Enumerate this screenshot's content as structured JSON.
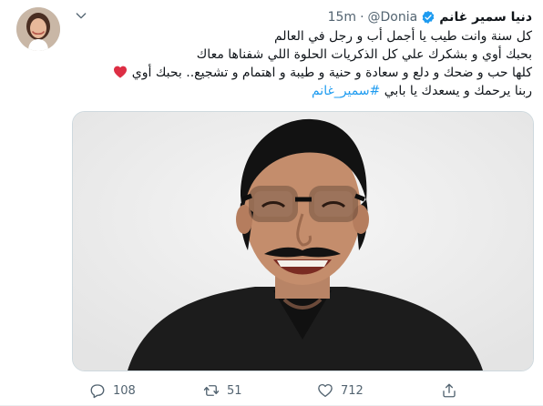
{
  "author": {
    "display_name": "دنيا سمير غانم",
    "handle": "@Donia",
    "separator": "·",
    "time": "15m",
    "verified_icon": "verified-badge-icon"
  },
  "tweet_text": {
    "line1": "كل سنة وانت طيب يا أجمل أب و رجل في العالم",
    "line2": "بحبك أوي و بشكرك علي كل الذكريات الحلوة اللي شفناها معاك",
    "line3": "كلها حب و ضحك و دلع و سعادة و حنية و طيبة و اهتمام و تشجيع.. بحبك أوي",
    "line4_text": "ربنا يرحمك و يسعدك يا بابي",
    "hashtag": "#سمير_غانم"
  },
  "media": {
    "icon": "photo-portrait"
  },
  "actions": {
    "reply_count": "108",
    "retweet_count": "51",
    "like_count": "712",
    "reply_icon": "reply-icon",
    "retweet_icon": "retweet-icon",
    "like_icon": "heart-icon",
    "share_icon": "share-icon"
  },
  "colors": {
    "accent": "#1d9bf0",
    "heart": "#e0245e",
    "secondary_text": "#536471"
  }
}
